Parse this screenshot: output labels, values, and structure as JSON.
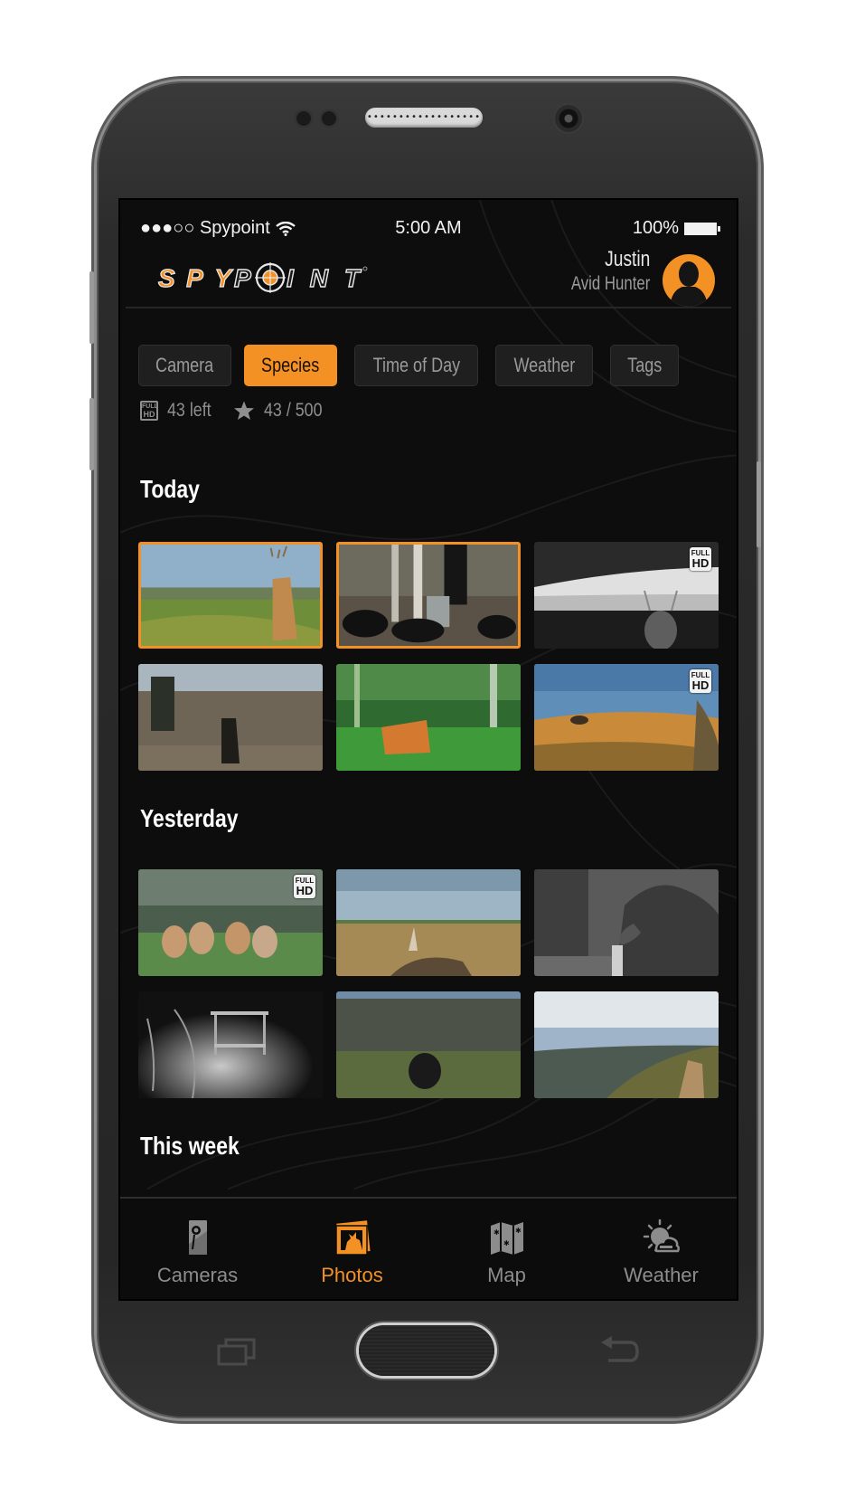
{
  "status_bar": {
    "carrier": "●●●○○ Spypoint",
    "time": "5:00 AM",
    "battery": "100%"
  },
  "header": {
    "logo_text": "SPYPOINT",
    "user_name": "Justin",
    "user_role": "Avid Hunter"
  },
  "filters": [
    {
      "label": "Camera",
      "active": false
    },
    {
      "label": "Species",
      "active": true
    },
    {
      "label": "Time of Day",
      "active": false
    },
    {
      "label": "Weather",
      "active": false
    },
    {
      "label": "Tags",
      "active": false
    }
  ],
  "stats": {
    "hd_left": "43 left",
    "favorites": "43 / 500"
  },
  "hd_badge": {
    "line1": "FULL",
    "line2": "HD"
  },
  "sections": [
    {
      "title": "Today",
      "photos": [
        {
          "subject": "buck in meadow",
          "selected": true,
          "full_hd": false
        },
        {
          "subject": "black bears at feeder",
          "selected": true,
          "full_hd": false
        },
        {
          "subject": "buck at night (infrared)",
          "selected": false,
          "full_hd": true
        },
        {
          "subject": "buck in brush",
          "selected": false,
          "full_hd": false
        },
        {
          "subject": "deer in green forest",
          "selected": false,
          "full_hd": false
        },
        {
          "subject": "deer in golden field",
          "selected": false,
          "full_hd": true
        }
      ]
    },
    {
      "title": "Yesterday",
      "photos": [
        {
          "subject": "herd of deer",
          "selected": false,
          "full_hd": true
        },
        {
          "subject": "turkey in field",
          "selected": false,
          "full_hd": false
        },
        {
          "subject": "moose (grayscale)",
          "selected": false,
          "full_hd": false
        },
        {
          "subject": "deer at feeder at night",
          "selected": false,
          "full_hd": false
        },
        {
          "subject": "turkey strutting",
          "selected": false,
          "full_hd": false
        },
        {
          "subject": "buck over valley",
          "selected": false,
          "full_hd": false
        }
      ]
    },
    {
      "title": "This week",
      "photos": []
    }
  ],
  "bottom_nav": [
    {
      "label": "Cameras",
      "icon": "camera-device-icon",
      "active": false
    },
    {
      "label": "Photos",
      "icon": "photos-icon",
      "active": true
    },
    {
      "label": "Map",
      "icon": "map-icon",
      "active": false
    },
    {
      "label": "Weather",
      "icon": "weather-icon",
      "active": false
    }
  ],
  "colors": {
    "accent": "#f39125",
    "background": "#0e0d0d",
    "chip_bg": "#1f1f1f",
    "muted_text": "#8c8c8c"
  }
}
